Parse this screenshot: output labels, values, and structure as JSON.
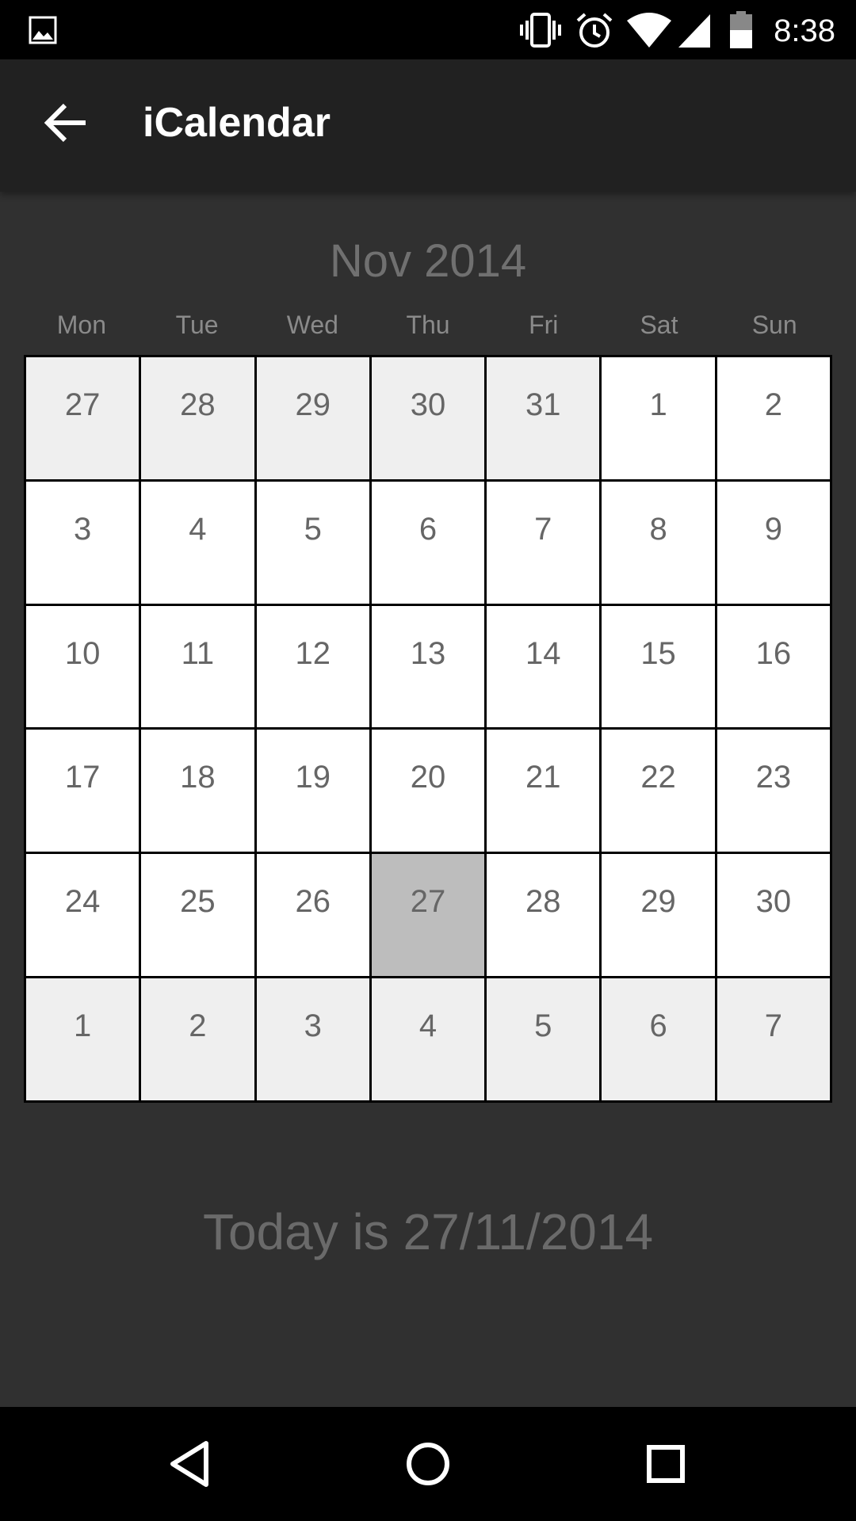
{
  "status_bar": {
    "time": "8:38",
    "icons": [
      "gallery-icon",
      "vibrate-icon",
      "alarm-icon",
      "wifi-icon",
      "signal-icon",
      "battery-icon"
    ]
  },
  "app_bar": {
    "title": "iCalendar",
    "back_icon": "arrow-back-icon"
  },
  "calendar": {
    "month_title": "Nov 2014",
    "weekdays": [
      "Mon",
      "Tue",
      "Wed",
      "Thu",
      "Fri",
      "Sat",
      "Sun"
    ],
    "weeks": [
      [
        {
          "d": "27",
          "t": "other"
        },
        {
          "d": "28",
          "t": "other"
        },
        {
          "d": "29",
          "t": "other"
        },
        {
          "d": "30",
          "t": "other"
        },
        {
          "d": "31",
          "t": "other"
        },
        {
          "d": "1",
          "t": "current"
        },
        {
          "d": "2",
          "t": "current"
        }
      ],
      [
        {
          "d": "3",
          "t": "current"
        },
        {
          "d": "4",
          "t": "current"
        },
        {
          "d": "5",
          "t": "current"
        },
        {
          "d": "6",
          "t": "current"
        },
        {
          "d": "7",
          "t": "current"
        },
        {
          "d": "8",
          "t": "current"
        },
        {
          "d": "9",
          "t": "current"
        }
      ],
      [
        {
          "d": "10",
          "t": "current"
        },
        {
          "d": "11",
          "t": "current"
        },
        {
          "d": "12",
          "t": "current"
        },
        {
          "d": "13",
          "t": "current"
        },
        {
          "d": "14",
          "t": "current"
        },
        {
          "d": "15",
          "t": "current"
        },
        {
          "d": "16",
          "t": "current"
        }
      ],
      [
        {
          "d": "17",
          "t": "current"
        },
        {
          "d": "18",
          "t": "current"
        },
        {
          "d": "19",
          "t": "current"
        },
        {
          "d": "20",
          "t": "current"
        },
        {
          "d": "21",
          "t": "current"
        },
        {
          "d": "22",
          "t": "current"
        },
        {
          "d": "23",
          "t": "current"
        }
      ],
      [
        {
          "d": "24",
          "t": "current"
        },
        {
          "d": "25",
          "t": "current"
        },
        {
          "d": "26",
          "t": "current"
        },
        {
          "d": "27",
          "t": "today"
        },
        {
          "d": "28",
          "t": "current"
        },
        {
          "d": "29",
          "t": "current"
        },
        {
          "d": "30",
          "t": "current"
        }
      ],
      [
        {
          "d": "1",
          "t": "other"
        },
        {
          "d": "2",
          "t": "other"
        },
        {
          "d": "3",
          "t": "other"
        },
        {
          "d": "4",
          "t": "other"
        },
        {
          "d": "5",
          "t": "other"
        },
        {
          "d": "6",
          "t": "other"
        },
        {
          "d": "7",
          "t": "other"
        }
      ]
    ]
  },
  "today_label": "Today is 27/11/2014",
  "nav_bar": {
    "icons": [
      "back-triangle-icon",
      "home-circle-icon",
      "recents-square-icon"
    ]
  },
  "colors": {
    "background": "#303030",
    "app_bar": "#212121",
    "cell_current": "#ffffff",
    "cell_other_month": "#efefef",
    "cell_today": "#bdbdbd"
  }
}
